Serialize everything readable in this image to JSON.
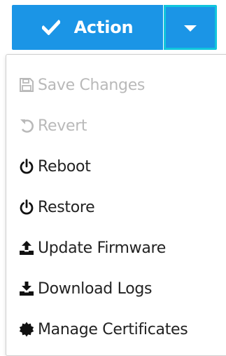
{
  "action_button": {
    "label": "Action",
    "icon": "check-icon",
    "toggle_icon": "caret-down-icon",
    "color": "#1b95e6",
    "toggle_border_color": "#11c5dd"
  },
  "menu": {
    "items": [
      {
        "label": "Save Changes",
        "icon": "floppy-disk-icon",
        "enabled": false
      },
      {
        "label": "Revert",
        "icon": "undo-icon",
        "enabled": false
      },
      {
        "label": "Reboot",
        "icon": "power-icon",
        "enabled": true
      },
      {
        "label": "Restore",
        "icon": "power-icon",
        "enabled": true
      },
      {
        "label": "Update Firmware",
        "icon": "upload-icon",
        "enabled": true
      },
      {
        "label": "Download Logs",
        "icon": "download-icon",
        "enabled": true
      },
      {
        "label": "Manage Certificates",
        "icon": "certificate-icon",
        "enabled": true
      }
    ]
  }
}
